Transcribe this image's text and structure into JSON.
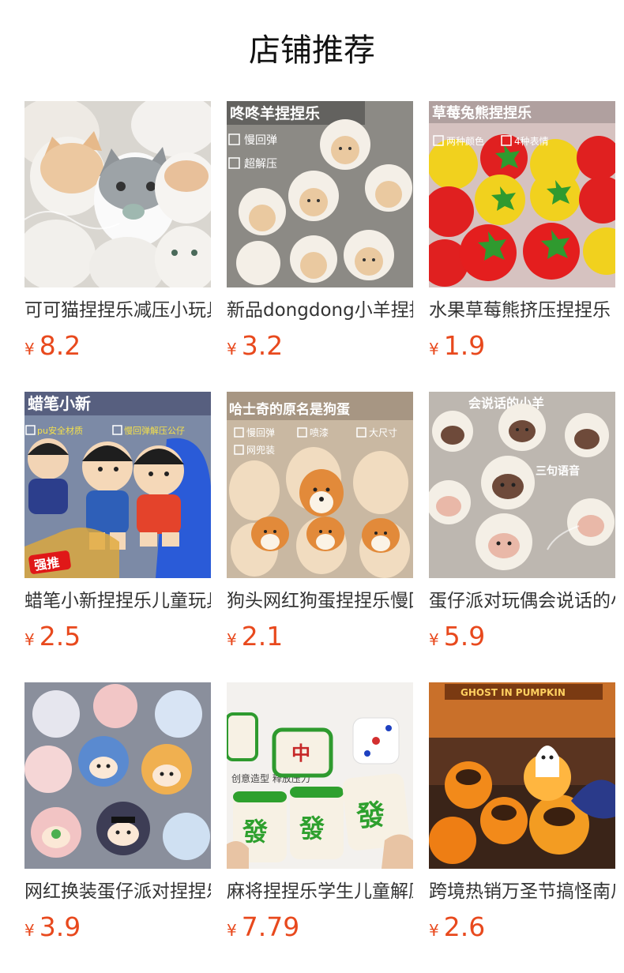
{
  "page": {
    "title": "店铺推荐"
  },
  "currency": "¥",
  "products": [
    {
      "name": "可可猫捏捏乐减压小玩具",
      "price": "8.2",
      "image": {
        "banner_lines": [],
        "checks": []
      }
    },
    {
      "name": "新品dongdong小羊捏捏乐",
      "price": "3.2",
      "image": {
        "banner_lines": [
          "咚咚羊捏捏乐"
        ],
        "checks": [
          "慢回弹",
          "超解压"
        ]
      }
    },
    {
      "name": "水果草莓熊挤压捏捏乐",
      "price": "1.9",
      "image": {
        "banner_lines": [
          "草莓兔熊捏捏乐"
        ],
        "checks": [
          "两种颜色",
          "4种表情"
        ]
      }
    },
    {
      "name": "蜡笔小新捏捏乐儿童玩具",
      "price": "2.5",
      "image": {
        "banner_lines": [
          "蜡笔小新"
        ],
        "checks": [
          "pu安全材质",
          "慢回弹解压公仔"
        ],
        "badge": "强推"
      }
    },
    {
      "name": "狗头网红狗蛋捏捏乐慢回弹",
      "price": "2.1",
      "image": {
        "banner_lines": [
          "哈士奇的原名是狗蛋"
        ],
        "checks": [
          "慢回弹",
          "喷漆",
          "大尺寸",
          "网兜装"
        ]
      }
    },
    {
      "name": "蛋仔派对玩偶会说话的小羊",
      "price": "5.9",
      "image": {
        "banner_lines": [
          "会说话的小羊",
          "三句语音"
        ],
        "checks": []
      }
    },
    {
      "name": "网红换装蛋仔派对捏捏乐",
      "price": "3.9",
      "image": {
        "banner_lines": [],
        "checks": []
      }
    },
    {
      "name": "麻将捏捏乐学生儿童解压",
      "price": "7.79",
      "image": {
        "banner_lines": [
          "创意造型 释放压力"
        ],
        "checks": []
      }
    },
    {
      "name": "跨境热销万圣节搞怪南瓜",
      "price": "2.6",
      "image": {
        "banner_lines": [
          "GHOST IN PUMPKIN"
        ],
        "checks": []
      }
    }
  ]
}
